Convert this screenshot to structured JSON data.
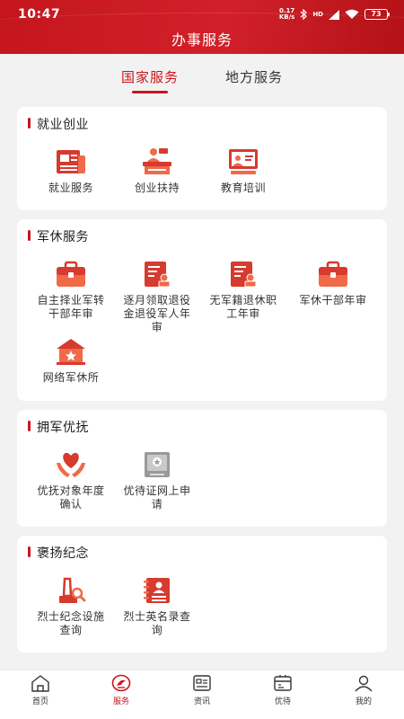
{
  "status_bar": {
    "time": "10:47",
    "net_speed_top": "0.17",
    "net_speed_bottom": "KB/s",
    "signal": "HD",
    "battery": "73"
  },
  "header": {
    "title": "办事服务"
  },
  "tabs": [
    {
      "label": "国家服务",
      "active": true
    },
    {
      "label": "地方服务",
      "active": false
    }
  ],
  "sections": [
    {
      "title": "就业创业",
      "items": [
        {
          "label": "就业服务",
          "icon": "newspaper-icon"
        },
        {
          "label": "创业扶持",
          "icon": "reception-desk-icon"
        },
        {
          "label": "教育培训",
          "icon": "teaching-board-icon"
        }
      ]
    },
    {
      "title": "军休服务",
      "items": [
        {
          "label": "自主择业军转干部年审",
          "icon": "briefcase-icon"
        },
        {
          "label": "逐月领取退役金退役军人年审",
          "icon": "document-stamp-icon"
        },
        {
          "label": "无军籍退休职工年审",
          "icon": "document-stamp-icon"
        },
        {
          "label": "军休干部年审",
          "icon": "briefcase-icon"
        },
        {
          "label": "网络军休所",
          "icon": "star-house-icon"
        }
      ]
    },
    {
      "title": "拥军优抚",
      "items": [
        {
          "label": "优抚对象年度确认",
          "icon": "heart-hands-icon"
        },
        {
          "label": "优待证网上申请",
          "icon": "star-certificate-icon"
        }
      ]
    },
    {
      "title": "褒扬纪念",
      "items": [
        {
          "label": "烈士纪念设施查询",
          "icon": "monument-search-icon"
        },
        {
          "label": "烈士英名录查询",
          "icon": "record-book-icon"
        }
      ]
    }
  ],
  "bottom_nav": [
    {
      "label": "首页",
      "icon": "home-icon",
      "active": false
    },
    {
      "label": "服务",
      "icon": "service-icon",
      "active": true
    },
    {
      "label": "资讯",
      "icon": "news-icon",
      "active": false
    },
    {
      "label": "优待",
      "icon": "benefits-icon",
      "active": false
    },
    {
      "label": "我的",
      "icon": "profile-icon",
      "active": false
    }
  ],
  "colors": {
    "primary": "#c8161d",
    "icon_accent": "#f06a4a",
    "background": "#f2f2f2"
  }
}
